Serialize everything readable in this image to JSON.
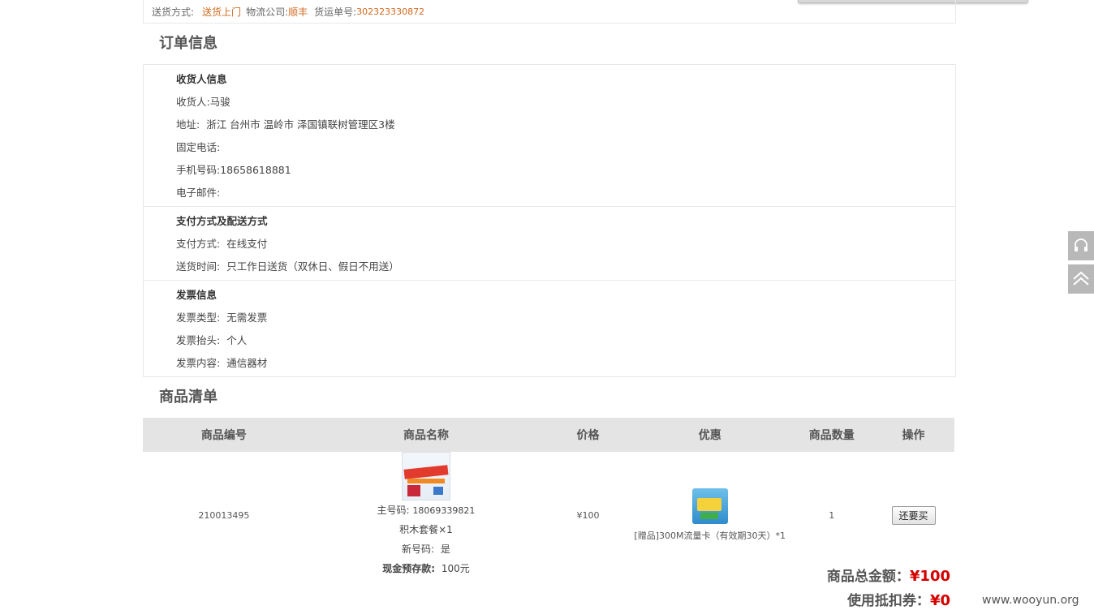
{
  "delivery": {
    "method_label": "送货方式:",
    "method_value": "送货上门",
    "carrier_label": "物流公司:",
    "carrier_value": "顺丰",
    "tracking_label": "货运单号:",
    "tracking_value": "302323330872"
  },
  "order_info": {
    "title": "订单信息",
    "consignee": {
      "heading": "收货人信息",
      "name_label": "收货人:",
      "name_value": "马骏",
      "address_label": "地址:",
      "address_value": "浙江 台州市 温岭市 泽国镇联树管理区3楼",
      "phone_label": "固定电话:",
      "phone_value": "",
      "mobile_label": "手机号码:",
      "mobile_value": "18658618881",
      "email_label": "电子邮件:",
      "email_value": ""
    },
    "payment": {
      "heading": "支付方式及配送方式",
      "pay_label": "支付方式:",
      "pay_value": "在线支付",
      "time_label": "送货时间:",
      "time_value": "只工作日送货（双休日、假日不用送）"
    },
    "invoice": {
      "heading": "发票信息",
      "type_label": "发票类型:",
      "type_value": "无需发票",
      "title_label": "发票抬头:",
      "title_value": "个人",
      "content_label": "发票内容:",
      "content_value": "通信器材"
    }
  },
  "product_list": {
    "title": "商品清单",
    "columns": [
      "商品编号",
      "商品名称",
      "价格",
      "优惠",
      "商品数量",
      "操作"
    ],
    "items": [
      {
        "id": "210013495",
        "main_number_label": "主号码:",
        "main_number": "18069339821",
        "package": "积木套餐×1",
        "new_number_label": "新号码:",
        "new_number": "是",
        "deposit_label": "现金预存款:",
        "deposit_value": "100元",
        "price": "¥100",
        "promo": "[赠品]300M流量卡（有效期30天）*1",
        "quantity": "1",
        "action": "还要买"
      }
    ]
  },
  "totals": {
    "total_label": "商品总金额：",
    "total_value": "¥100",
    "coupon_label": "使用抵扣券：",
    "coupon_value": "¥0"
  },
  "watermark": "www.wooyun.org",
  "icons": {
    "service": "headset-icon",
    "top": "chevron-up-icon"
  }
}
